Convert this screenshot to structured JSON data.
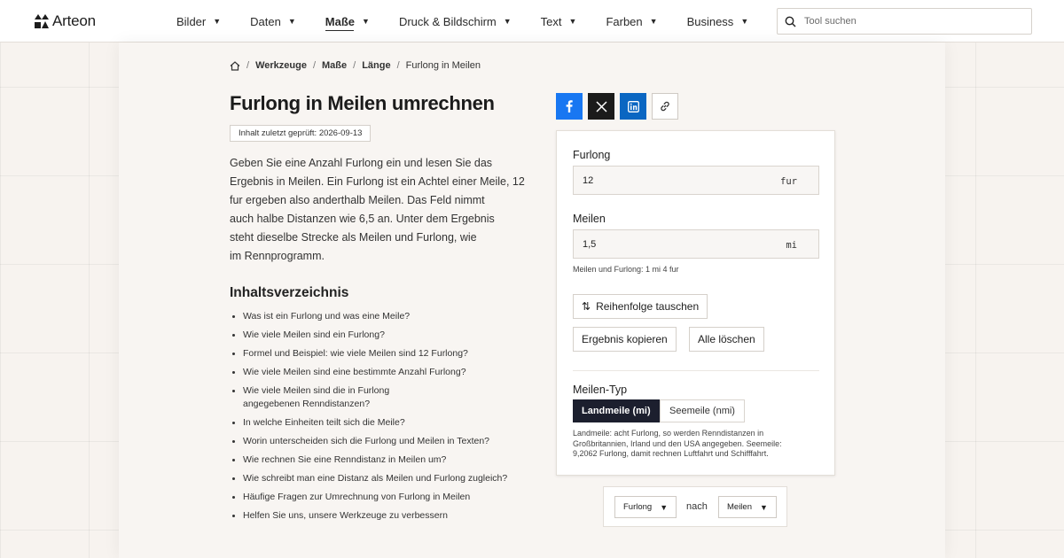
{
  "brand": {
    "name": "Arteon"
  },
  "nav": [
    {
      "label": "Bilder",
      "active": false
    },
    {
      "label": "Daten",
      "active": false
    },
    {
      "label": "Maße",
      "active": true
    },
    {
      "label": "Druck & Bildschirm",
      "active": false
    },
    {
      "label": "Text",
      "active": false
    },
    {
      "label": "Farben",
      "active": false
    },
    {
      "label": "Business",
      "active": false
    }
  ],
  "search": {
    "placeholder": "Tool suchen"
  },
  "breadcrumb": {
    "items": [
      "Werkzeuge",
      "Maße",
      "Länge"
    ],
    "current": "Furlong in Meilen"
  },
  "page": {
    "title": "Furlong in Meilen umrechnen",
    "checked": "Inhalt zuletzt geprüft: 2026-09-13",
    "intro_lines": [
      "Geben Sie eine Anzahl Furlong ein und lesen Sie das",
      "Ergebnis in Meilen. Ein Furlong ist ein Achtel einer Meile, 12",
      "fur ergeben also anderthalb Meilen. Das Feld nimmt",
      "auch halbe Distanzen wie 6,5 an. Unter dem Ergebnis",
      "steht dieselbe Strecke als Meilen und Furlong, wie",
      "im Rennprogramm."
    ]
  },
  "toc": {
    "title": "Inhaltsverzeichnis",
    "items": [
      [
        "Was ist ein Furlong und was eine Meile?"
      ],
      [
        "Wie viele Meilen sind ein Furlong?"
      ],
      [
        "Formel und Beispiel: wie viele Meilen sind 12 Furlong?"
      ],
      [
        "Wie viele Meilen sind eine bestimmte Anzahl Furlong?"
      ],
      [
        "Wie viele Meilen sind die in Furlong",
        "angegebenen Renndistanzen?"
      ],
      [
        "In welche Einheiten teilt sich die Meile?"
      ],
      [
        "Worin unterscheiden sich die Furlong und Meilen in Texten?"
      ],
      [
        "Wie rechnen Sie eine Renndistanz in Meilen um?"
      ],
      [
        "Wie schreibt man eine Distanz als Meilen und Furlong zugleich?"
      ],
      [
        "Häufige Fragen zur Umrechnung von Furlong in Meilen"
      ],
      [
        "Helfen Sie uns, unsere Werkzeuge zu verbessern"
      ]
    ]
  },
  "converter": {
    "from_label": "Furlong",
    "from_value": "12",
    "from_unit": "fur",
    "to_label": "Meilen",
    "to_value": "1,5",
    "to_unit": "mi",
    "hint": "Meilen und Furlong: 1 mi 4 fur",
    "swap_label": "Reihenfolge tauschen",
    "copy_label": "Ergebnis kopieren",
    "clear_label": "Alle löschen",
    "type_label": "Meilen-Typ",
    "type_options": [
      "Landmeile (mi)",
      "Seemeile (nmi)"
    ],
    "type_selected": "Landmeile (mi)",
    "type_note_lines": [
      "Landmeile: acht Furlong, so werden Renndistanzen in",
      "Großbritannien, Irland und den USA angegeben. Seemeile:",
      "9,2062 Furlong, damit rechnen Luftfahrt und Schifffahrt."
    ]
  },
  "unit_selector": {
    "from": "Furlong",
    "connector": "nach",
    "to": "Meilen"
  },
  "colors": {
    "facebook": "#1877f2",
    "x": "#1b1b1b",
    "linkedin": "#0a66c2",
    "active_segment": "#1c1f2e"
  }
}
